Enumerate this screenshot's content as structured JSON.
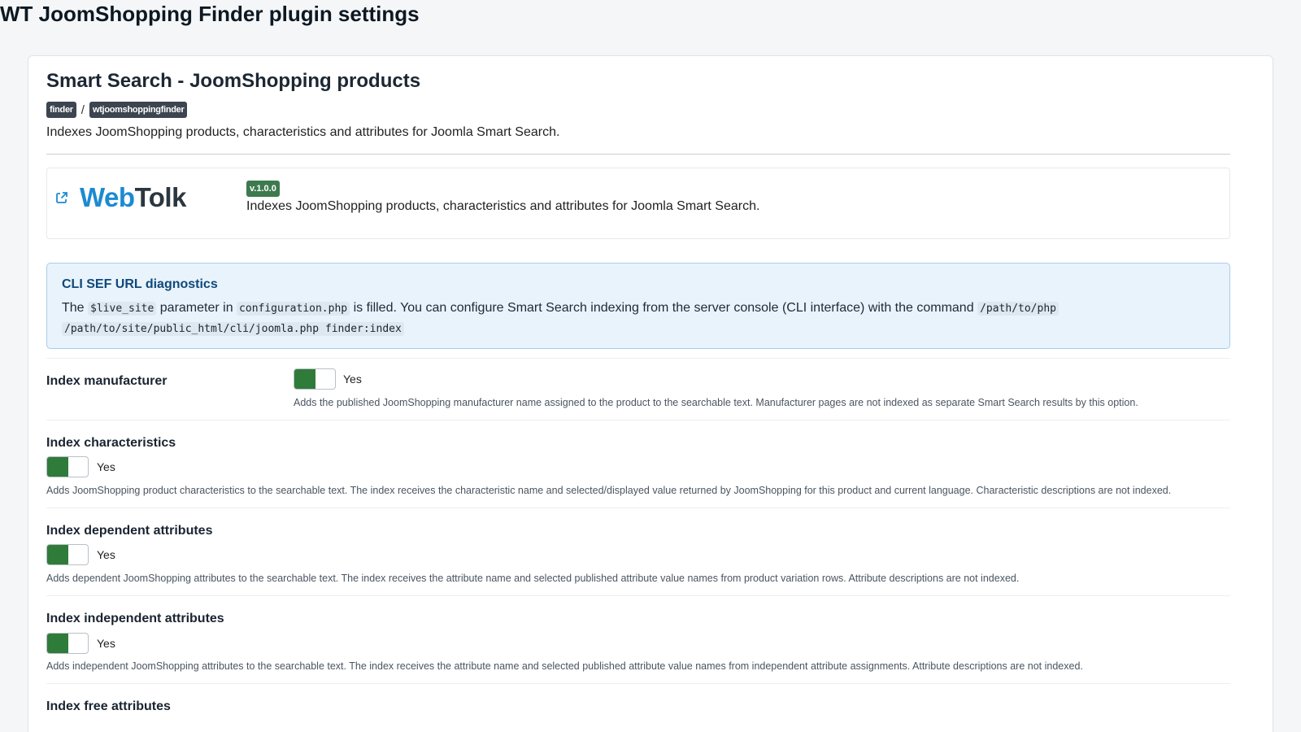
{
  "page": {
    "title": "WT JoomShopping Finder plugin settings"
  },
  "plugin": {
    "title": "Smart Search - JoomShopping products",
    "tags": [
      "finder",
      "wtjoomshoppingfinder"
    ],
    "tag_separator": "/",
    "description": "Indexes JoomShopping products, characteristics and attributes for Joomla Smart Search."
  },
  "brand": {
    "logo_part1": "Web",
    "logo_part2": "Tolk",
    "version": "v.1.0.0",
    "description": "Indexes JoomShopping products, characteristics and attributes for Joomla Smart Search.",
    "colors": {
      "web": "#1c8ad2",
      "tolk": "#2b3640",
      "badge": "#3d7a4e"
    }
  },
  "alert": {
    "title": "CLI SEF URL diagnostics",
    "text_1": "The",
    "code_1": "$live_site",
    "text_2": "parameter in",
    "code_2": "configuration.php",
    "text_3": "is filled. You can configure Smart Search indexing from the server console (CLI interface) with the command",
    "code_3": "/path/to/php",
    "code_4": "/path/to/site/public_html/cli/joomla.php finder:index"
  },
  "fields": [
    {
      "label": "Index manufacturer",
      "value": "Yes",
      "enabled": true,
      "help": "Adds the published JoomShopping manufacturer name assigned to the product to the searchable text. Manufacturer pages are not indexed as separate Smart Search results by this option."
    },
    {
      "label": "Index characteristics",
      "value": "Yes",
      "enabled": true,
      "help": "Adds JoomShopping product characteristics to the searchable text. The index receives the characteristic name and selected/displayed value returned by JoomShopping for this product and current language. Characteristic descriptions are not indexed."
    },
    {
      "label": "Index dependent attributes",
      "value": "Yes",
      "enabled": true,
      "help": "Adds dependent JoomShopping attributes to the searchable text. The index receives the attribute name and selected published attribute value names from product variation rows. Attribute descriptions are not indexed."
    },
    {
      "label": "Index independent attributes",
      "value": "Yes",
      "enabled": true,
      "help": "Adds independent JoomShopping attributes to the searchable text. The index receives the attribute name and selected published attribute value names from independent attribute assignments. Attribute descriptions are not indexed."
    },
    {
      "label": "Index free attributes"
    }
  ],
  "colors": {
    "toggle_on": "#2f7b3a",
    "alert_bg": "#e8f3fc",
    "alert_title": "#10487a"
  },
  "icons": {
    "external_link": "external-link-icon"
  }
}
